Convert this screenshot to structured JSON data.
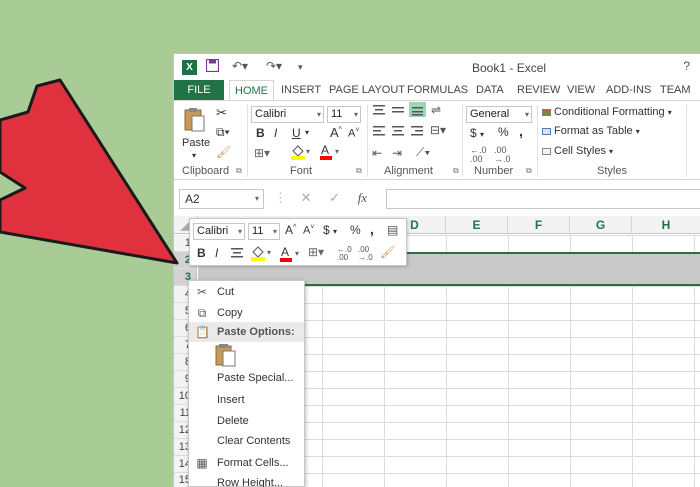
{
  "window": {
    "title": "Book1 - Excel",
    "logo": "X",
    "quick_access": [
      "save-icon",
      "undo-icon",
      "redo-icon",
      "customize-icon"
    ],
    "control": "?"
  },
  "tabs": [
    "FILE",
    "HOME",
    "INSERT",
    "PAGE LAYOUT",
    "FORMULAS",
    "DATA",
    "REVIEW",
    "VIEW",
    "ADD-INS",
    "TEAM"
  ],
  "active_tab": "HOME",
  "ribbon": {
    "clipboard": {
      "paste_label": "Paste",
      "group_label": "Clipboard"
    },
    "font": {
      "font_name": "Calibri",
      "font_size": "11",
      "bold": "B",
      "italic": "I",
      "underline": "U",
      "grow": "A",
      "shrink": "A",
      "group_label": "Font"
    },
    "alignment": {
      "group_label": "Alignment"
    },
    "number": {
      "format": "General",
      "currency": "$",
      "percent": "%",
      "comma": ",",
      "group_label": "Number"
    },
    "styles": {
      "conditional": "Conditional Formatting",
      "format_table": "Format as Table",
      "cell_styles": "Cell Styles",
      "group_label": "Styles"
    },
    "colors": {
      "accent": "#217346",
      "highlight": "#ffff00",
      "font_color": "#ff0000"
    }
  },
  "formula_bar": {
    "name_box": "A2",
    "fx": "fx",
    "cancel": "✕",
    "enter": "✓"
  },
  "grid": {
    "columns": [
      "D",
      "E",
      "F",
      "G",
      "H"
    ],
    "rows": [
      "1",
      "2",
      "3",
      "4",
      "5",
      "6",
      "7",
      "8",
      "9",
      "10",
      "11",
      "12",
      "13",
      "14",
      "15"
    ]
  },
  "mini_toolbar": {
    "font_name": "Calibri",
    "font_size": "11",
    "grow": "A",
    "shrink": "A",
    "currency": "$",
    "percent": "%",
    "comma": ",",
    "bold": "B",
    "italic": "I"
  },
  "context_menu": {
    "cut": "Cut",
    "copy": "Copy",
    "paste_options": "Paste Options:",
    "paste_special": "Paste Special...",
    "insert": "Insert",
    "delete": "Delete",
    "clear_contents": "Clear Contents",
    "format_cells": "Format Cells...",
    "row_height": "Row Height..."
  },
  "colors": {
    "background": "#a9cc97",
    "arrow": "#e0313e"
  }
}
